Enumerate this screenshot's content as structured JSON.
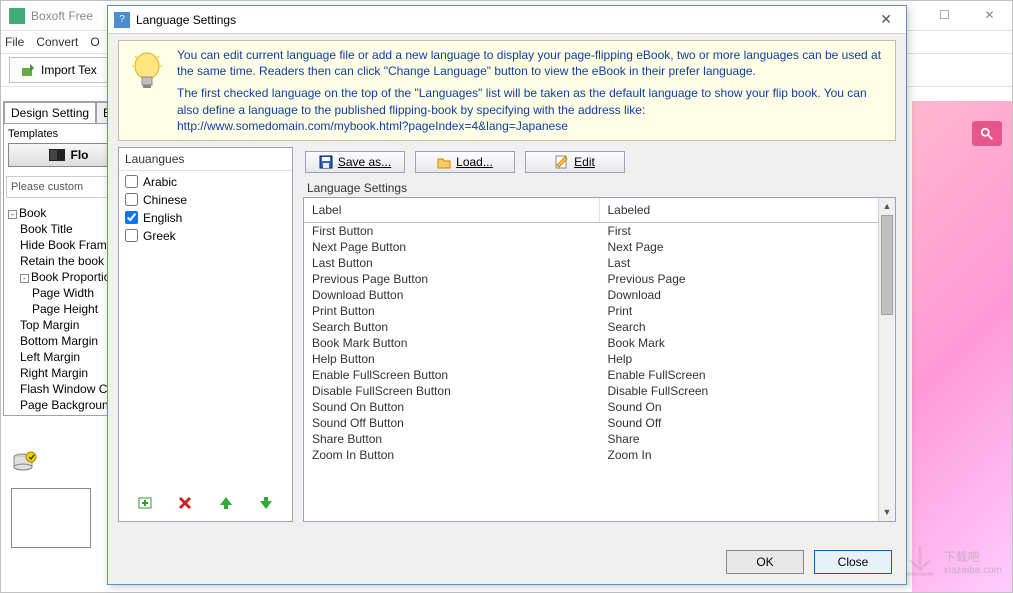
{
  "mainWindow": {
    "title": "Boxoft Free"
  },
  "menubar": {
    "items": [
      "File",
      "Convert",
      "O"
    ]
  },
  "toolbar": {
    "importLabel": "Import Tex"
  },
  "leftPanel": {
    "tabs": [
      "Design Setting",
      "Bo"
    ],
    "templatesLabel": "Templates",
    "templatesBtn": "Flo",
    "note": "Please custom",
    "tree": [
      {
        "lvl": 1,
        "exp": "-",
        "label": "Book"
      },
      {
        "lvl": 2,
        "exp": "",
        "label": "Book Title"
      },
      {
        "lvl": 2,
        "exp": "",
        "label": "Hide Book Fram"
      },
      {
        "lvl": 2,
        "exp": "",
        "label": "Retain the book"
      },
      {
        "lvl": 2,
        "exp": "-",
        "label": "Book Proportion"
      },
      {
        "lvl": 3,
        "exp": "",
        "label": "Page Width"
      },
      {
        "lvl": 3,
        "exp": "",
        "label": "Page Height"
      },
      {
        "lvl": 2,
        "exp": "",
        "label": "Top Margin"
      },
      {
        "lvl": 2,
        "exp": "",
        "label": "Bottom Margin"
      },
      {
        "lvl": 2,
        "exp": "",
        "label": "Left Margin"
      },
      {
        "lvl": 2,
        "exp": "",
        "label": "Right Margin"
      },
      {
        "lvl": 2,
        "exp": "",
        "label": "Flash Window C"
      },
      {
        "lvl": 2,
        "exp": "",
        "label": "Page Backgroun"
      }
    ]
  },
  "dialog": {
    "title": "Language Settings",
    "info1": "You can edit current language file or add a new language to display your page-flipping eBook, two or more languages can be used at the same time. Readers then can click \"Change Language\" button to view the eBook in their prefer language.",
    "info2": "The first checked language on the top of the \"Languages\" list will be taken as the default language to show your flip book. You can also define a language to the published flipping-book by specifying with the address like:",
    "infoLink": "http://www.somedomain.com/mybook.html?pageIndex=4&lang=Japanese",
    "langPanel": {
      "header": "Lauangues",
      "items": [
        {
          "label": "Arabic",
          "checked": false
        },
        {
          "label": "Chinese",
          "checked": false
        },
        {
          "label": "English",
          "checked": true
        },
        {
          "label": "Greek",
          "checked": false
        }
      ]
    },
    "btns": {
      "saveas": "Save as...",
      "load": "Load...",
      "edit": "Edit"
    },
    "gridLabel": "Language Settings",
    "gridHeaders": [
      "Label",
      "Labeled"
    ],
    "gridRows": [
      [
        "First Button",
        "First"
      ],
      [
        "Next Page Button",
        "Next Page"
      ],
      [
        "Last Button",
        "Last"
      ],
      [
        "Previous Page Button",
        "Previous Page"
      ],
      [
        "Download Button",
        "Download"
      ],
      [
        "Print Button",
        "Print"
      ],
      [
        "Search Button",
        "Search"
      ],
      [
        "Book Mark Button",
        "Book Mark"
      ],
      [
        "Help Button",
        "Help"
      ],
      [
        "Enable FullScreen Button",
        "Enable FullScreen"
      ],
      [
        "Disable FullScreen Button",
        "Disable FullScreen"
      ],
      [
        "Sound On Button",
        "Sound On"
      ],
      [
        "Sound Off Button",
        "Sound Off"
      ],
      [
        "Share Button",
        "Share"
      ],
      [
        "Zoom In Button",
        "Zoom In"
      ]
    ],
    "ok": "OK",
    "close": "Close"
  },
  "watermark": {
    "text": "下载吧",
    "sub": "xiazaiba.com"
  }
}
